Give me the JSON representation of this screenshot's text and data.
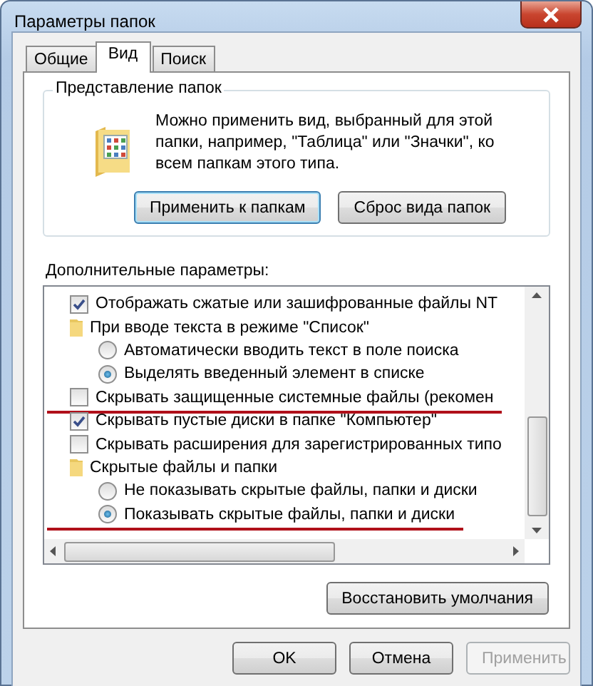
{
  "window": {
    "title": "Параметры папок"
  },
  "tabs": [
    {
      "label": "Общие",
      "selected": false
    },
    {
      "label": "Вид",
      "selected": true
    },
    {
      "label": "Поиск",
      "selected": false
    }
  ],
  "folder_views": {
    "title": "Представление папок",
    "description": "Можно применить вид, выбранный для этой папки, например, \"Таблица\" или \"Значки\", ко всем папкам этого типа.",
    "buttons": [
      {
        "label": "Применить к папкам",
        "focused": true
      },
      {
        "label": "Сброс вида папок",
        "focused": false
      }
    ]
  },
  "advanced": {
    "label": "Дополнительные параметры:",
    "items": [
      {
        "kind": "checkbox",
        "label": "Отображать сжатые или зашифрованные файлы NT",
        "checked": true,
        "underlined": false
      },
      {
        "kind": "folder",
        "label": "При вводе текста в режиме \"Список\"",
        "underlined": false,
        "children": [
          {
            "kind": "radio",
            "label": "Автоматически вводить текст в поле поиска",
            "selected": false,
            "underlined": false
          },
          {
            "kind": "radio",
            "label": "Выделять введенный элемент в списке",
            "selected": true,
            "underlined": false
          }
        ]
      },
      {
        "kind": "checkbox",
        "label": "Скрывать защищенные системные файлы (рекомен",
        "checked": false,
        "underlined": true
      },
      {
        "kind": "checkbox",
        "label": "Скрывать пустые диски в папке \"Компьютер\"",
        "checked": true,
        "underlined": false
      },
      {
        "kind": "checkbox",
        "label": "Скрывать расширения для зарегистрированных типо",
        "checked": false,
        "underlined": false
      },
      {
        "kind": "folder",
        "label": "Скрытые файлы и папки",
        "underlined": false,
        "children": [
          {
            "kind": "radio",
            "label": "Не показывать скрытые файлы, папки и диски",
            "selected": false,
            "underlined": false
          },
          {
            "kind": "radio",
            "label": "Показывать скрытые файлы, папки и диски",
            "selected": true,
            "underlined": true
          }
        ]
      }
    ]
  },
  "restore_button": "Восстановить умолчания",
  "buttons": [
    {
      "label": "OK",
      "disabled": false
    },
    {
      "label": "Отмена",
      "disabled": false
    },
    {
      "label": "Применить",
      "disabled": true
    }
  ]
}
